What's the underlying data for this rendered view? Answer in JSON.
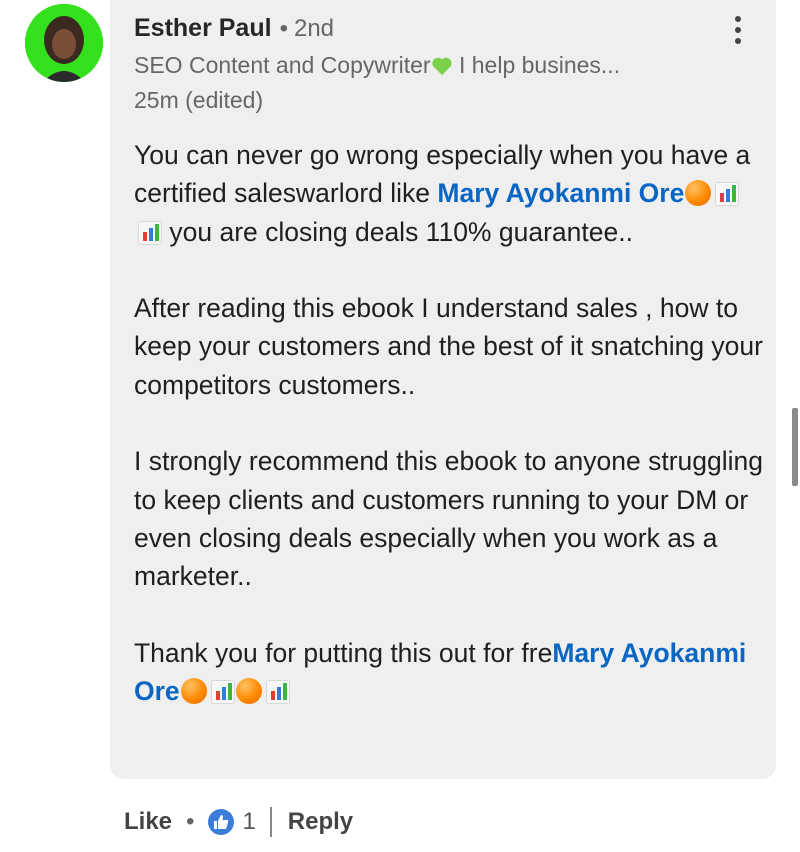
{
  "comment": {
    "author": "Esther Paul",
    "connection": "2nd",
    "headline_prefix": "SEO Content and Copywriter",
    "headline_suffix": " I help busines...",
    "timestamp": "25m (edited)",
    "p1_pre": "You can never go wrong especially when you have a certified saleswarlord like ",
    "p1_mention": "Mary Ayokanmi Ore",
    "p1_post": "  you are closing deals 110% guarantee..",
    "p2": "After reading this ebook I understand sales , how to keep your customers and the best of it snatching your competitors customers..",
    "p3": "I strongly recommend this ebook to anyone struggling to keep clients and customers running to your DM or even closing deals especially when you work as a marketer..",
    "p4_pre": "Thank you for putting this out for fre",
    "p4_mention": "Mary Ayokanmi Ore"
  },
  "actions": {
    "like_label": "Like",
    "reaction_count": "1",
    "reply_label": "Reply"
  },
  "icons": {
    "reaction": "thumbs-up-icon",
    "more": "more-vertical-icon"
  },
  "colors": {
    "mention": "#0a66c2",
    "avatar_bg": "#33e11c",
    "bubble_bg": "#efefef"
  }
}
